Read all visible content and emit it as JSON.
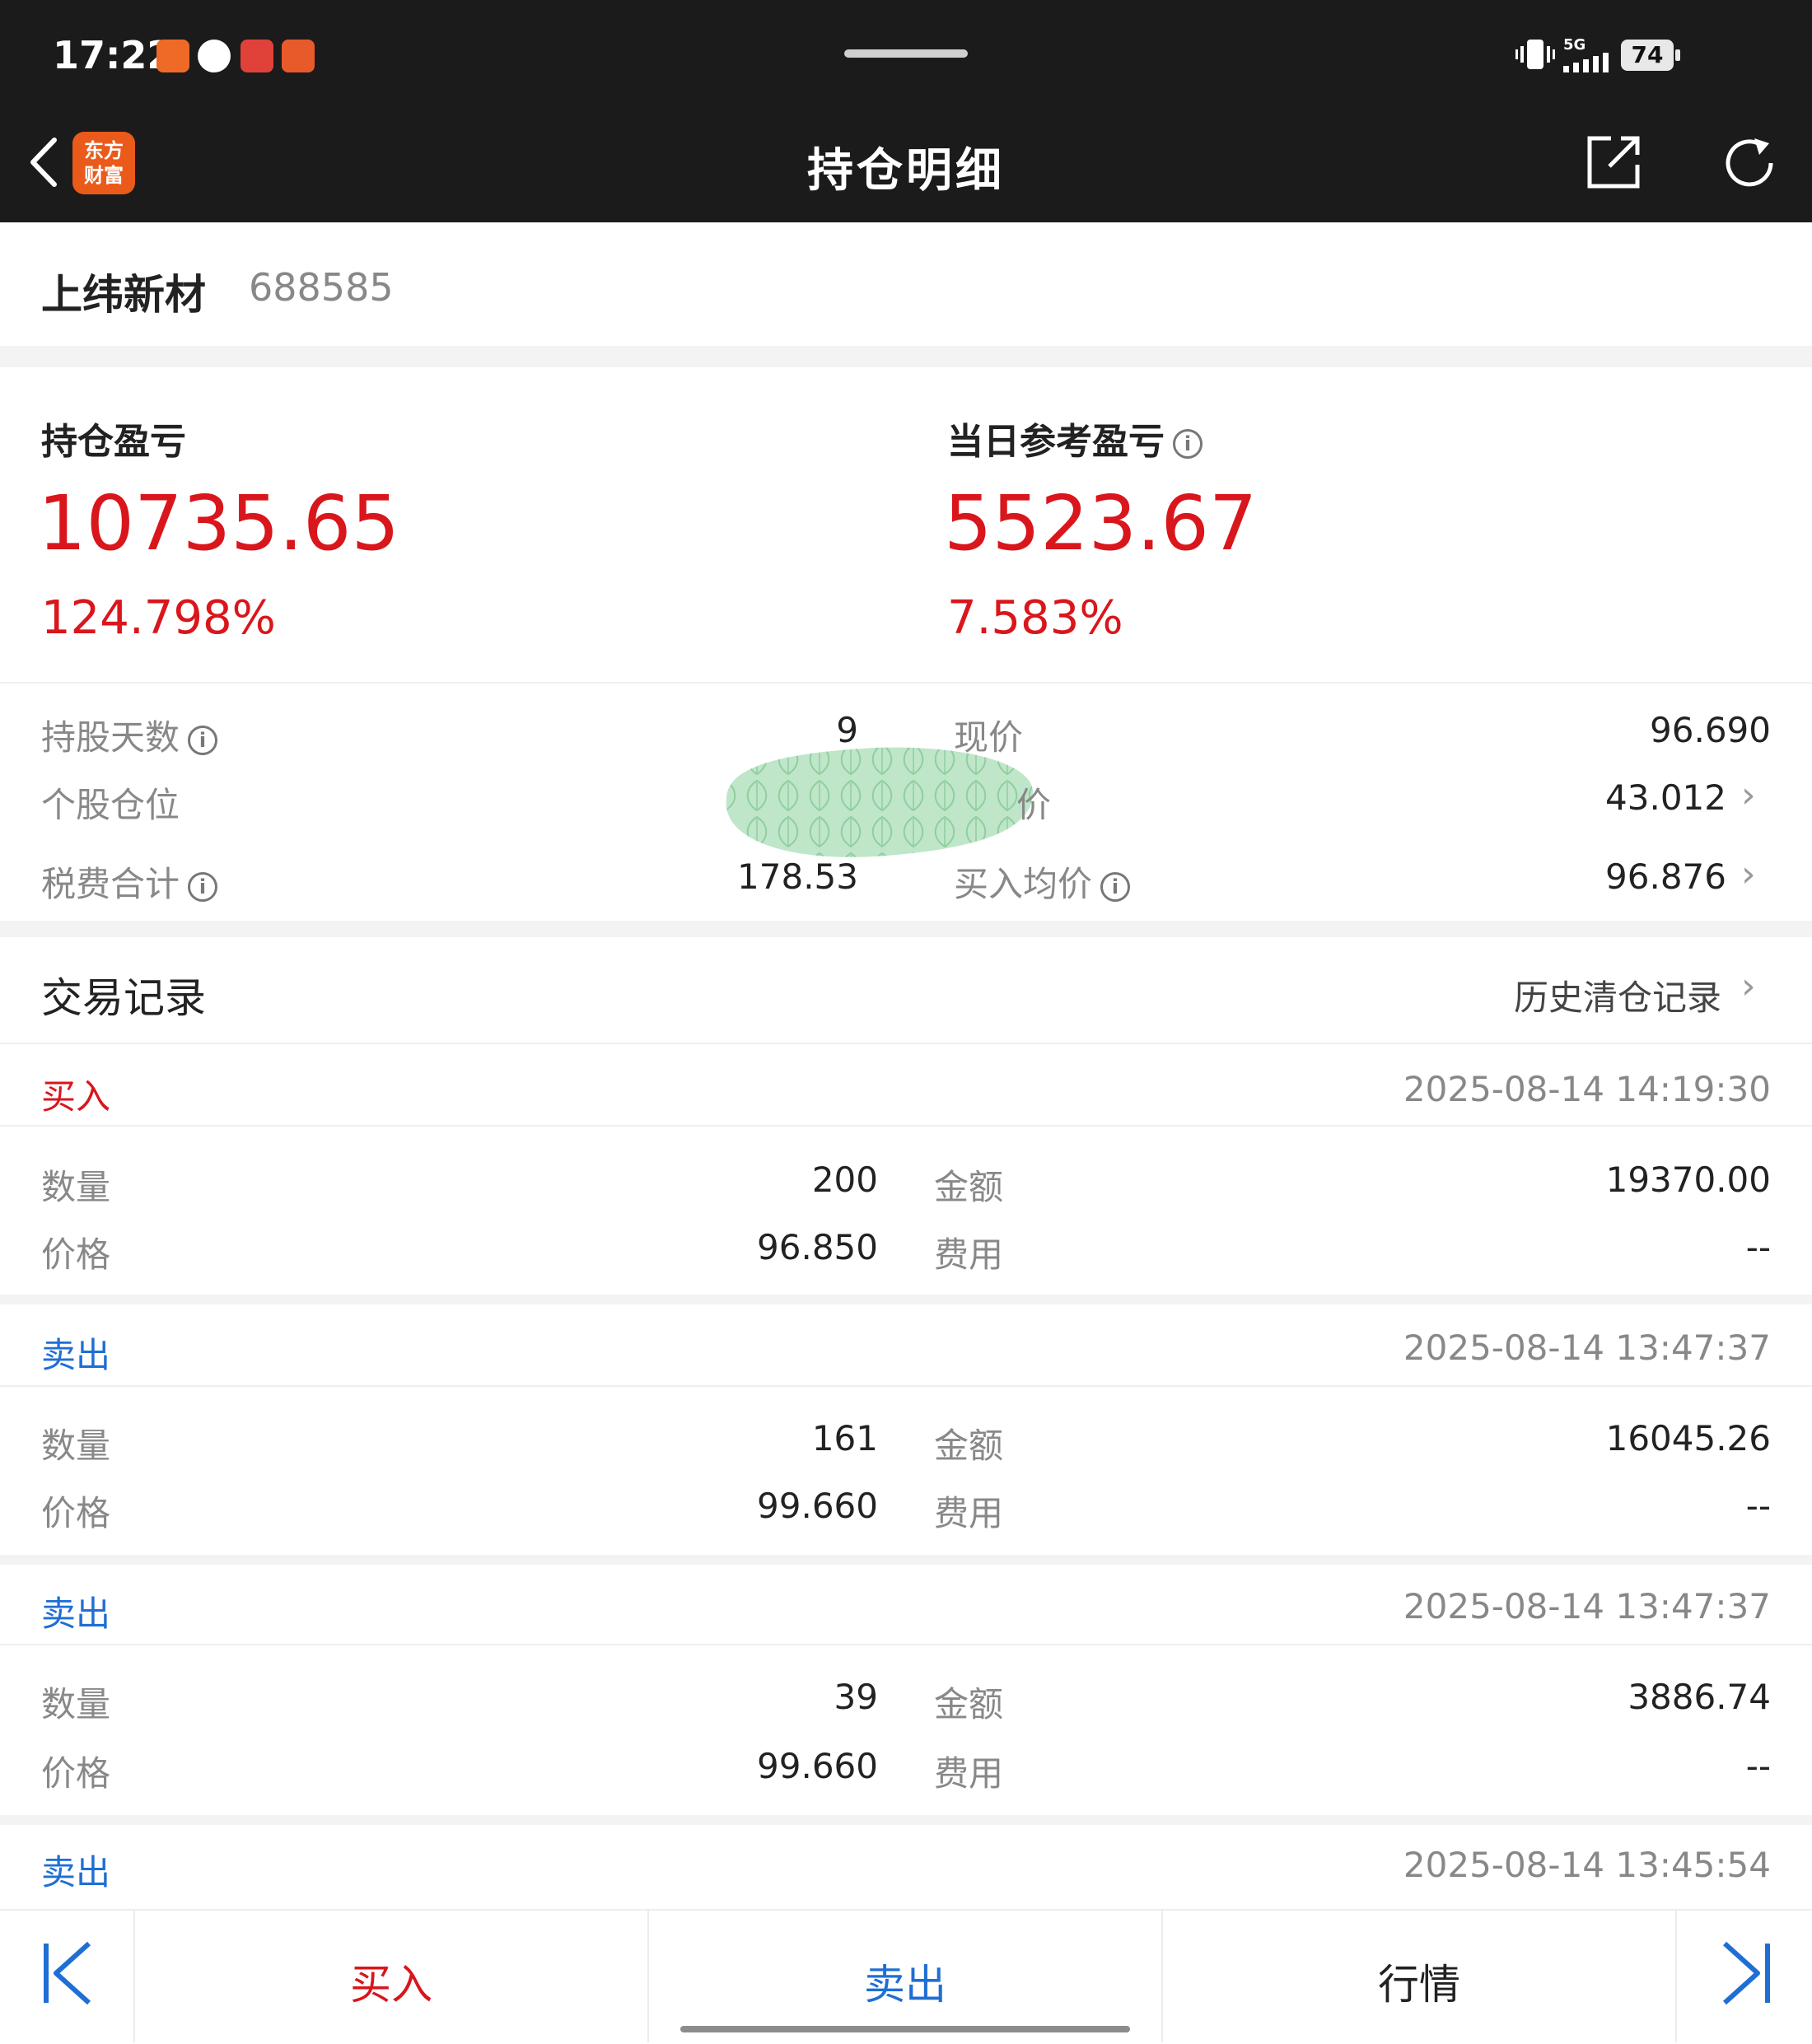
{
  "status_bar": {
    "time": "17:22",
    "network": "5G",
    "battery": "74"
  },
  "header": {
    "logo_text": "东方\n财富",
    "title": "持仓明细"
  },
  "stock": {
    "name": "上纬新材",
    "code": "688585"
  },
  "summary": {
    "position_pl_label": "持仓盈亏",
    "position_pl_value": "10735.65",
    "position_pl_pct": "124.798%",
    "daily_pl_label": "当日参考盈亏",
    "daily_pl_value": "5523.67",
    "daily_pl_pct": "7.583%"
  },
  "details": {
    "hold_days_label": "持股天数",
    "hold_days_value": "9",
    "position_ratio_label": "个股仓位",
    "fees_label": "税费合计",
    "fees_value": "178.53",
    "current_price_label": "现价",
    "current_price_value": "96.690",
    "cost_price_value": "43.012",
    "buy_avg_label": "买入均价",
    "buy_avg_value": "96.876"
  },
  "trades_section": {
    "title": "交易记录",
    "history_link": "历史清仓记录"
  },
  "trades": [
    {
      "type": "买入",
      "time": "2025-08-14 14:19:30",
      "qty_label": "数量",
      "qty": "200",
      "amount_label": "金额",
      "amount": "19370.00",
      "price_label": "价格",
      "price": "96.850",
      "fee_label": "费用",
      "fee": "--"
    },
    {
      "type": "卖出",
      "time": "2025-08-14 13:47:37",
      "qty_label": "数量",
      "qty": "161",
      "amount_label": "金额",
      "amount": "16045.26",
      "price_label": "价格",
      "price": "99.660",
      "fee_label": "费用",
      "fee": "--"
    },
    {
      "type": "卖出",
      "time": "2025-08-14 13:47:37",
      "qty_label": "数量",
      "qty": "39",
      "amount_label": "金额",
      "amount": "3886.74",
      "price_label": "价格",
      "price": "99.660",
      "fee_label": "费用",
      "fee": "--"
    },
    {
      "type": "卖出",
      "time": "2025-08-14 13:45:54"
    }
  ],
  "bottom_bar": {
    "buy": "买入",
    "sell": "卖出",
    "quote": "行情"
  },
  "colors": {
    "red": "#d9161c",
    "blue": "#1f6ed4",
    "header_bg": "#1b1b1b"
  }
}
